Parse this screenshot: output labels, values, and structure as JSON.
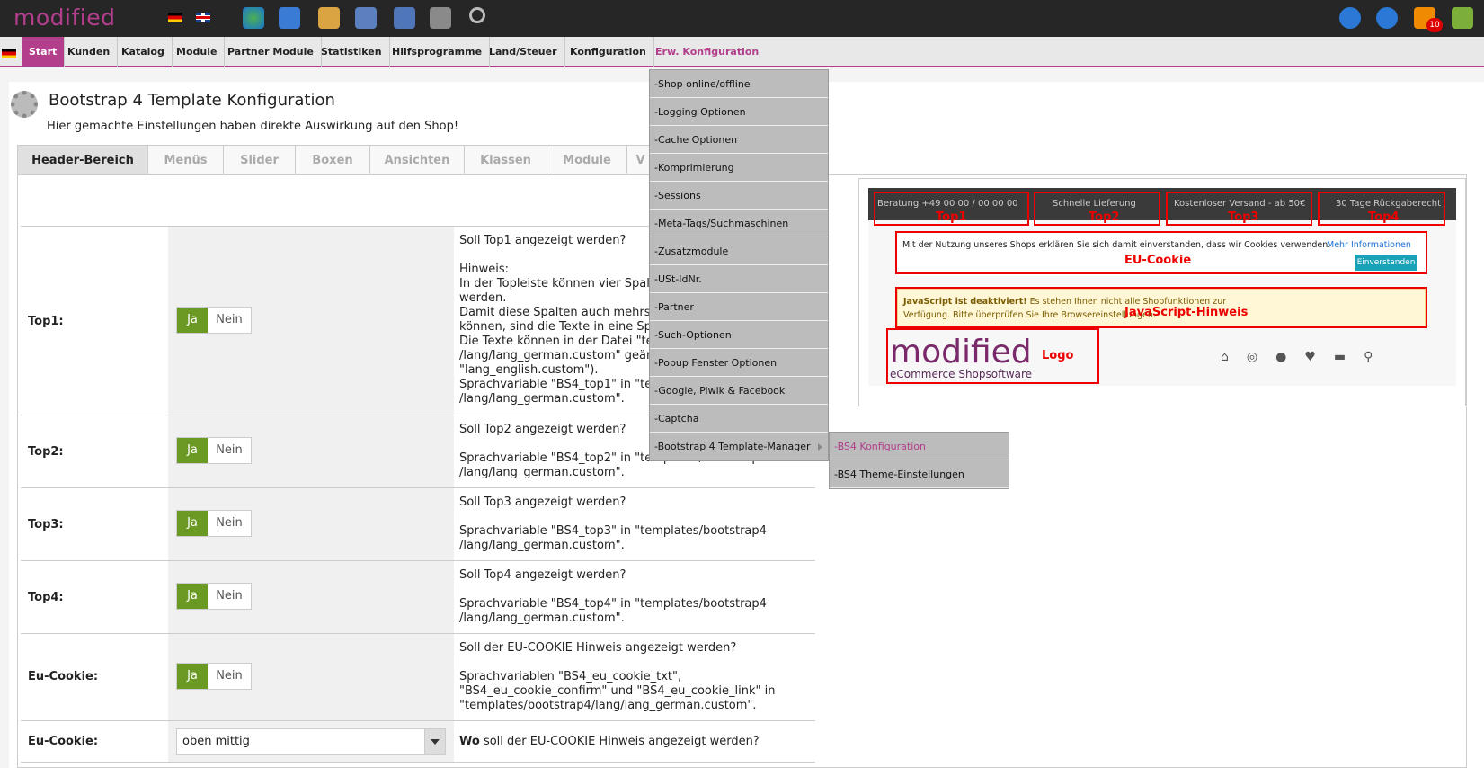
{
  "topbar": {
    "logo": "modified",
    "badge": "10"
  },
  "menu": [
    "Start",
    "Kunden",
    "Katalog",
    "Module",
    "Partner Module",
    "Statistiken",
    "Hilfsprogramme",
    "Land/Steuer",
    "Konfiguration",
    "Erw. Konfiguration"
  ],
  "page": {
    "title": "Bootstrap 4 Template Konfiguration",
    "subtitle": "Hier gemachte Einstellungen haben direkte Auswirkung auf den Shop!"
  },
  "tabs": [
    "Header-Bereich",
    "Menüs",
    "Slider",
    "Boxen",
    "Ansichten",
    "Klassen",
    "Module",
    "V"
  ],
  "rows": [
    {
      "label": "Top1:",
      "ja": "Ja",
      "nein": "Nein",
      "desc": "Soll Top1 angezeigt werden?\n\nHinweis:\nIn der Topleiste können vier Spalt\nwerden.\nDamit diese Spalten auch mehrsp\nkönnen, sind die Texte in eine Spr\nDie Texte können in der Datei \"te\n/lang/lang_german.custom\" geän\n\"lang_english.custom\").\nSprachvariable \"BS4_top1\" in \"ter\n/lang/lang_german.custom\"."
    },
    {
      "label": "Top2:",
      "ja": "Ja",
      "nein": "Nein",
      "desc": "Soll Top2 angezeigt werden?\n\nSprachvariable \"BS4_top2\" in \"templates/bootstrap4\n/lang/lang_german.custom\"."
    },
    {
      "label": "Top3:",
      "ja": "Ja",
      "nein": "Nein",
      "desc": "Soll Top3 angezeigt werden?\n\nSprachvariable \"BS4_top3\" in \"templates/bootstrap4\n/lang/lang_german.custom\"."
    },
    {
      "label": "Top4:",
      "ja": "Ja",
      "nein": "Nein",
      "desc": "Soll Top4 angezeigt werden?\n\nSprachvariable \"BS4_top4\" in \"templates/bootstrap4\n/lang/lang_german.custom\"."
    },
    {
      "label": "Eu-Cookie:",
      "ja": "Ja",
      "nein": "Nein",
      "desc": "Soll der EU-COOKIE Hinweis angezeigt werden?\n\nSprachvariablen \"BS4_eu_cookie_txt\",\n\"BS4_eu_cookie_confirm\" und \"BS4_eu_cookie_link\" in\n\"templates/bootstrap4/lang/lang_german.custom\"."
    },
    {
      "label": "Eu-Cookie:",
      "select": "oben mittig",
      "desc_b": "Wo",
      "desc": " soll der EU-COOKIE Hinweis angezeigt werden?"
    }
  ],
  "dropdown": [
    "-Shop online/offline",
    "-Logging Optionen",
    "-Cache Optionen",
    "-Komprimierung",
    "-Sessions",
    "-Meta-Tags/Suchmaschinen",
    "-Zusatzmodule",
    "-USt-IdNr.",
    "-Partner",
    "-Such-Optionen",
    "-Popup Fenster Optionen",
    "-Google, Piwik & Facebook",
    "-Captcha",
    "-Bootstrap 4 Template-Manager"
  ],
  "submenu": [
    "-BS4 Konfiguration",
    "-BS4 Theme-Einstellungen"
  ],
  "preview": {
    "top1": "Beratung +49 00 00 / 00 00 00",
    "top2": "Schnelle Lieferung",
    "top3": "Kostenloser Versand - ab 50€",
    "top4": "30 Tage Rückgaberecht",
    "lbl_top1": "Top1",
    "lbl_top2": "Top2",
    "lbl_top3": "Top3",
    "lbl_top4": "Top4",
    "cookie_text": "Mit der Nutzung unseres Shops erklären Sie sich damit einverstanden, dass wir Cookies verwenden.",
    "cookie_link": "Mehr Informationen",
    "cookie_btn": "Einverstanden",
    "lbl_cookie": "EU-Cookie",
    "js_bold": "JavaScript ist deaktiviert!",
    "js_text": " Es stehen Ihnen nicht alle Shopfunktionen zur Verfügung. Bitte überprüfen Sie Ihre Browsereinstellungen.",
    "lbl_js": "JavaScript-Hinweis",
    "logo": "modified",
    "logo_sub": "eCommerce Shopsoftware",
    "lbl_logo": "Logo"
  }
}
